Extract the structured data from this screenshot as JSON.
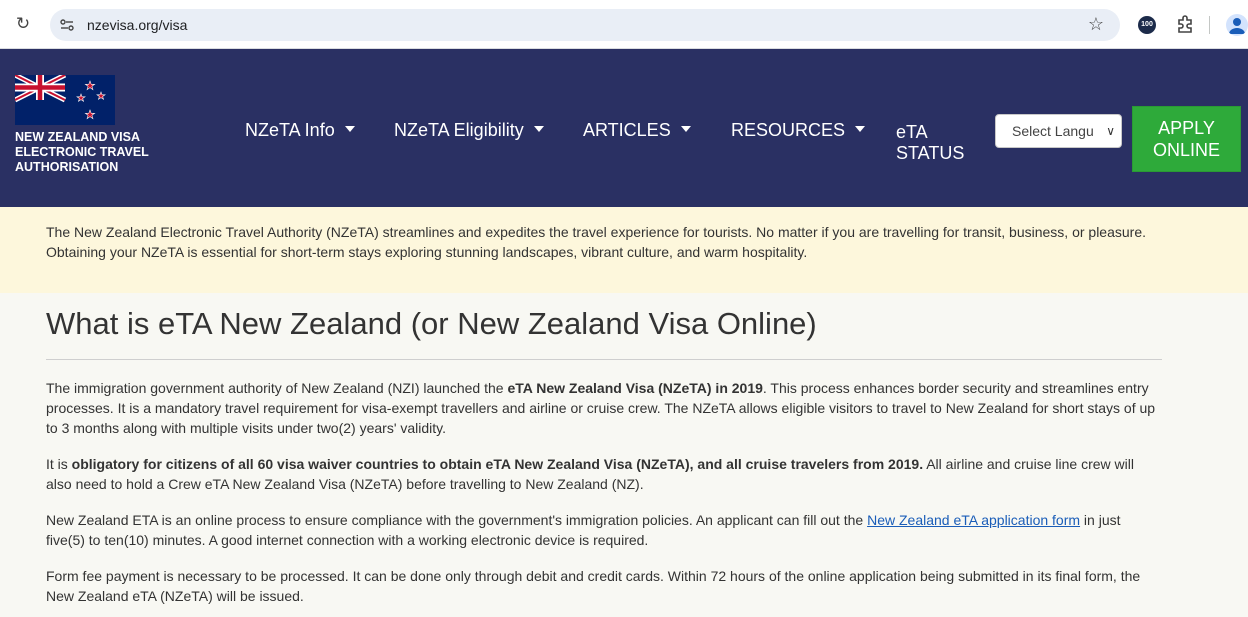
{
  "browser": {
    "url": "nzevisa.org/visa",
    "extension_badge": "100"
  },
  "header": {
    "brand_line1": "NEW ZEALAND VISA",
    "brand_line2": "ELECTRONIC TRAVEL",
    "brand_line3": "AUTHORISATION",
    "nav": [
      {
        "label": "NZeTA Info"
      },
      {
        "label": "NZeTA Eligibility"
      },
      {
        "label": "ARTICLES"
      },
      {
        "label": "RESOURCES"
      }
    ],
    "eta_status_line1": "eTA",
    "eta_status_line2": "STATUS",
    "language_select": "Select Langu",
    "apply_line1": "APPLY",
    "apply_line2": "ONLINE"
  },
  "notice": {
    "text": "The New Zealand Electronic Travel Authority (NZeTA) streamlines and expedites the travel experience for tourists. No matter if you are travelling for transit, business, or pleasure. Obtaining your NZeTA is essential for short-term stays exploring stunning landscapes, vibrant culture, and warm hospitality."
  },
  "main": {
    "title": "What is eTA New Zealand (or New Zealand Visa Online)",
    "p1_a": "The immigration government authority of New Zealand (NZI) launched the ",
    "p1_bold": "eTA New Zealand Visa (NZeTA) in 2019",
    "p1_b": ". This process enhances border security and streamlines entry processes. It is a mandatory travel requirement for visa-exempt travellers and airline or cruise crew. The NZeTA allows eligible visitors to travel to New Zealand for short stays of up to 3 months along with multiple visits under two(2) years' validity.",
    "p2_a": "It is ",
    "p2_bold": "obligatory for citizens of all 60 visa waiver countries to obtain eTA New Zealand Visa (NZeTA), and all cruise travelers from 2019.",
    "p2_b": " All airline and cruise line crew will also need to hold a Crew eTA New Zealand Visa (NZeTA) before travelling to New Zealand (NZ).",
    "p3_a": "New Zealand ETA is an online process to ensure compliance with the government's immigration policies. An applicant can fill out the ",
    "p3_link": "New Zealand eTA application form",
    "p3_b": " in just five(5) to ten(10) minutes. A good internet connection with a working electronic device is required.",
    "p4": "Form fee payment is necessary to be processed. It can be done only through debit and credit cards. Within 72 hours of the online application being submitted in its final form, the New Zealand eTA (NZeTA) will be issued."
  },
  "colors": {
    "header_bg": "#2a3063",
    "notice_bg": "#fdf7dc",
    "apply_green": "#2eaa3a",
    "link": "#1a5db8"
  }
}
